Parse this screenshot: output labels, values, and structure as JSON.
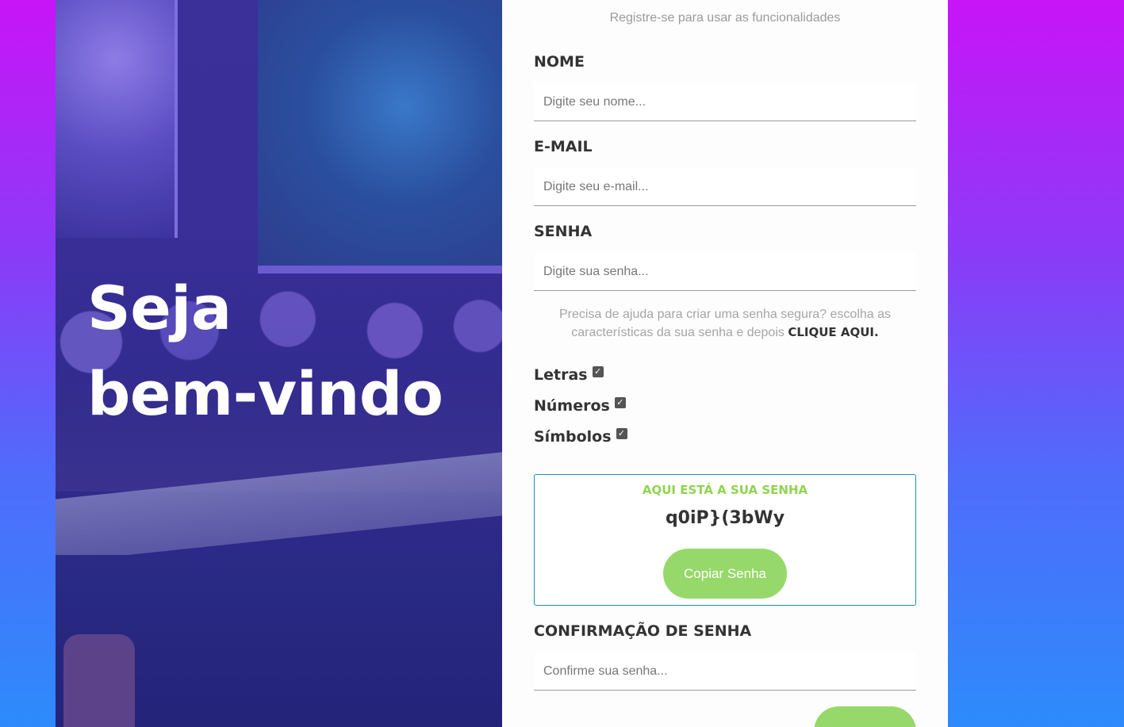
{
  "hero": {
    "title_line1": "Seja",
    "title_line2": "bem-vindo"
  },
  "form": {
    "subtitle": "Registre-se para usar as funcionalidades",
    "name": {
      "label": "NOME",
      "placeholder": "Digite seu nome..."
    },
    "email": {
      "label": "E-MAIL",
      "placeholder": "Digite seu e-mail..."
    },
    "password": {
      "label": "SENHA",
      "placeholder": "Digite sua senha..."
    },
    "help_text": "Precisa de ajuda para criar uma senha segura? escolha as características da sua senha e depois",
    "help_link": "CLIQUE AQUI.",
    "options": [
      {
        "label": "Letras",
        "checked": true
      },
      {
        "label": "Números",
        "checked": true
      },
      {
        "label": "Símbolos",
        "checked": true
      }
    ],
    "generated": {
      "heading": "AQUI ESTÁ A SUA SENHA",
      "value": "q0iP}(3bWy",
      "copy_label": "Copiar Senha"
    },
    "confirm": {
      "label": "CONFIRMAÇÃO DE SENHA",
      "placeholder": "Confirme sua senha..."
    }
  },
  "colors": {
    "accent_green": "#97d86a",
    "heading_green": "#8fd44f",
    "box_border": "#1a8dc4",
    "bg_top": "#c814f7",
    "bg_bottom": "#2d8bfb"
  }
}
